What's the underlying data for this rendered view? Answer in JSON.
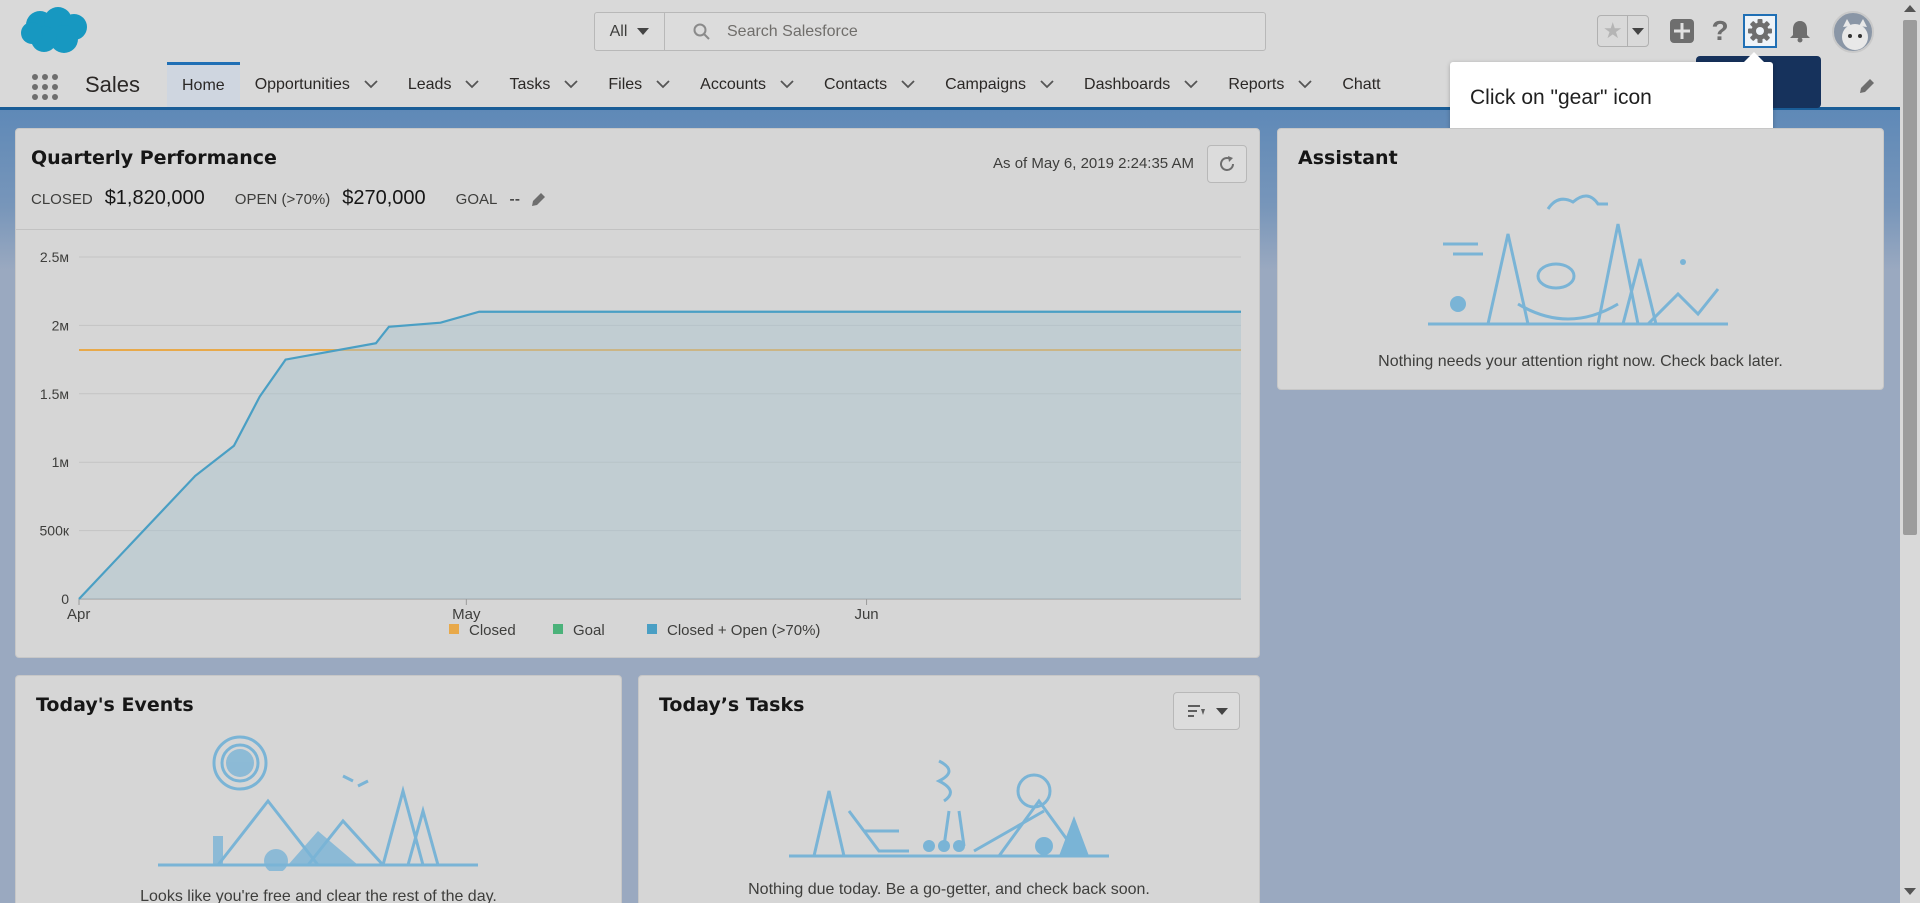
{
  "header": {
    "search_scope": "All",
    "search_placeholder": "Search Salesforce"
  },
  "nav": {
    "app_name": "Sales",
    "items": [
      {
        "label": "Home",
        "has_menu": false,
        "active": true
      },
      {
        "label": "Opportunities",
        "has_menu": true
      },
      {
        "label": "Leads",
        "has_menu": true
      },
      {
        "label": "Tasks",
        "has_menu": true
      },
      {
        "label": "Files",
        "has_menu": true
      },
      {
        "label": "Accounts",
        "has_menu": true
      },
      {
        "label": "Contacts",
        "has_menu": true
      },
      {
        "label": "Campaigns",
        "has_menu": true
      },
      {
        "label": "Dashboards",
        "has_menu": true
      },
      {
        "label": "Reports",
        "has_menu": true
      },
      {
        "label": "Chatt",
        "has_menu": false
      }
    ]
  },
  "tooltip": {
    "text": "Click on \"gear\" icon"
  },
  "quarterly": {
    "title": "Quarterly Performance",
    "as_of": "As of May 6, 2019 2:24:35 AM",
    "closed_label": "CLOSED",
    "closed_value": "$1,820,000",
    "open_label": "OPEN (>70%)",
    "open_value": "$270,000",
    "goal_label": "GOAL",
    "goal_value": "--"
  },
  "chart_data": {
    "type": "line",
    "title": "",
    "xlabel": "",
    "ylabel": "",
    "x_ticks": [
      "Apr",
      "May",
      "Jun"
    ],
    "y_ticks": [
      "0",
      "500к",
      "1м",
      "1.5м",
      "2м",
      "2.5м"
    ],
    "ylim": [
      0,
      2500000
    ],
    "xlim_days": [
      0,
      90
    ],
    "grid": true,
    "legend_position": "bottom",
    "legend": [
      "Closed",
      "Goal",
      "Closed + Open (>70%)"
    ],
    "series": [
      {
        "name": "Closed",
        "color": "#e8a94a",
        "type": "line",
        "points": [
          [
            0,
            1820000
          ],
          [
            90,
            1820000
          ]
        ]
      },
      {
        "name": "Closed + Open (>70%)",
        "color": "#4a9fc4",
        "type": "area",
        "points": [
          [
            0,
            0
          ],
          [
            9,
            900000
          ],
          [
            12,
            1120000
          ],
          [
            14,
            1480000
          ],
          [
            16,
            1750000
          ],
          [
            23,
            1870000
          ],
          [
            24,
            1990000
          ],
          [
            28,
            2020000
          ],
          [
            31,
            2100000
          ],
          [
            90,
            2100000
          ]
        ]
      }
    ],
    "legend_colors": [
      "#e8a94a",
      "#4bb27a",
      "#4a9fc4"
    ]
  },
  "assistant": {
    "title": "Assistant",
    "message": "Nothing needs your attention right now. Check back later."
  },
  "events": {
    "title": "Today's Events",
    "message": "Looks like you're free and clear the rest of the day."
  },
  "tasks": {
    "title": "Today’s Tasks",
    "message": "Nothing due today. Be a go-getter, and check back soon."
  }
}
